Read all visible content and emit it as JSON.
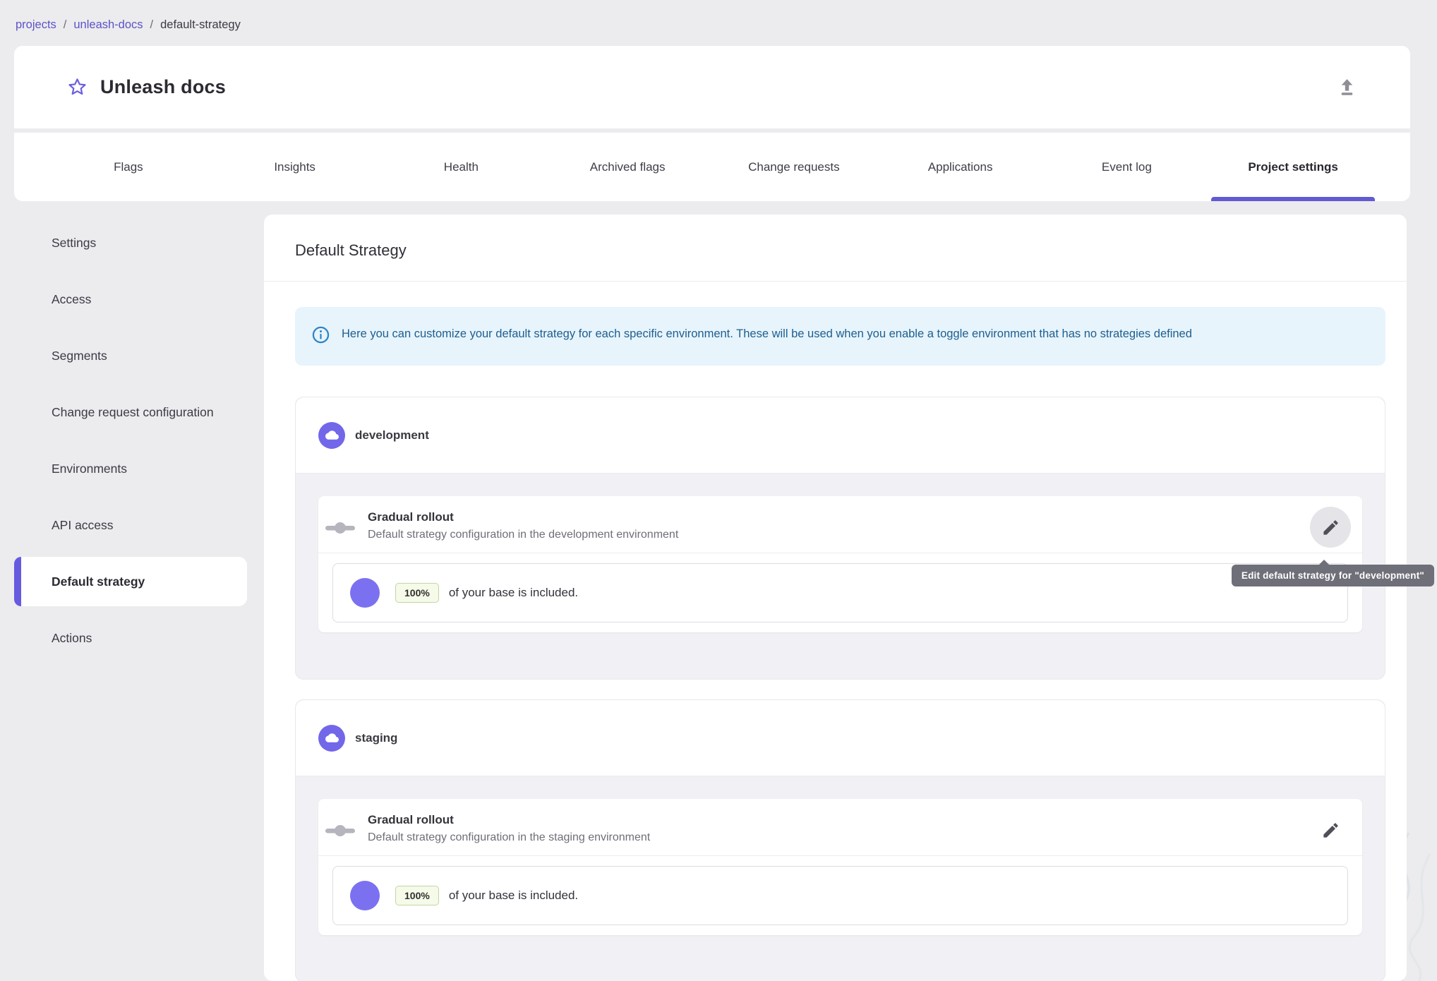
{
  "breadcrumb": {
    "separator": "/",
    "items": [
      {
        "label": "projects",
        "link": true
      },
      {
        "label": "unleash-docs",
        "link": true
      },
      {
        "label": "default-strategy",
        "link": false
      }
    ]
  },
  "header": {
    "title": "Unleash docs"
  },
  "tabs": {
    "items": [
      {
        "label": "Flags",
        "active": false
      },
      {
        "label": "Insights",
        "active": false
      },
      {
        "label": "Health",
        "active": false
      },
      {
        "label": "Archived flags",
        "active": false
      },
      {
        "label": "Change requests",
        "active": false
      },
      {
        "label": "Applications",
        "active": false
      },
      {
        "label": "Event log",
        "active": false
      },
      {
        "label": "Project settings",
        "active": true
      }
    ]
  },
  "sidebar": {
    "items": [
      {
        "label": "Settings"
      },
      {
        "label": "Access"
      },
      {
        "label": "Segments"
      },
      {
        "label": "Change request configuration"
      },
      {
        "label": "Environments"
      },
      {
        "label": "API access"
      },
      {
        "label": "Default strategy"
      },
      {
        "label": "Actions"
      }
    ],
    "active": "Default strategy"
  },
  "main": {
    "title": "Default Strategy",
    "alert": {
      "text": "Here you can customize your default strategy for each specific environment. These will be used when you enable a toggle environment that has no strategies defined"
    },
    "environments": [
      {
        "name": "development",
        "strategy": {
          "title": "Gradual rollout",
          "description": "Default strategy configuration in the development environment"
        },
        "rollout": {
          "percent": "100%",
          "text": "of your base is included."
        },
        "edit_tooltip": "Edit default strategy for \"development\""
      },
      {
        "name": "staging",
        "strategy": {
          "title": "Gradual rollout",
          "description": "Default strategy configuration in the staging environment"
        },
        "rollout": {
          "percent": "100%",
          "text": "of your base is included."
        }
      }
    ]
  },
  "colors": {
    "accent_purple": "#615bd2",
    "env_icon_purple": "#7267e9",
    "rollout_circle_purple": "#7b71f0",
    "alert_background": "#e7f4fc",
    "alert_text": "#1d5e8f",
    "chip_background": "#f5fae9",
    "chip_border": "#c3d6a4",
    "tooltip_background": "#6f6f79",
    "page_background": "#ecebee"
  }
}
